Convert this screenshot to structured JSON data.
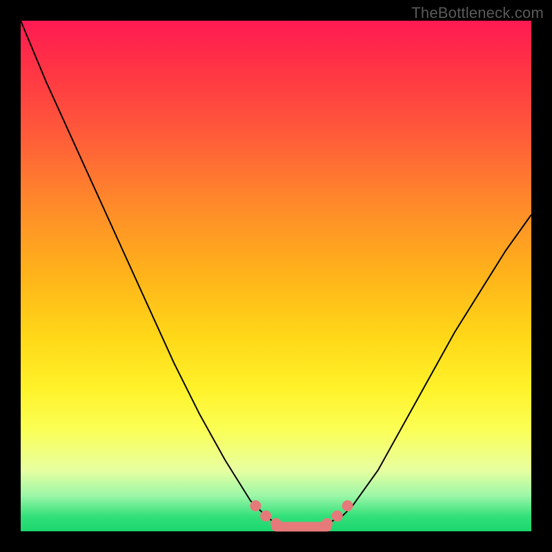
{
  "watermark": "TheBottleneck.com",
  "colors": {
    "frame": "#000000",
    "curve": "#000000",
    "markers": "#e67a7a",
    "gradient_top": "#ff1a53",
    "gradient_bottom": "#1bd66e"
  },
  "chart_data": {
    "type": "line",
    "title": "",
    "xlabel": "",
    "ylabel": "",
    "xlim": [
      0,
      100
    ],
    "ylim": [
      0,
      100
    ],
    "x": [
      0,
      5,
      10,
      15,
      20,
      25,
      30,
      35,
      40,
      45,
      48,
      50,
      53,
      56,
      60,
      63,
      65,
      70,
      75,
      80,
      85,
      90,
      95,
      100
    ],
    "y": [
      100,
      88,
      77,
      66,
      55,
      44,
      33,
      23,
      14,
      6,
      3,
      1.5,
      0.8,
      0.8,
      1.5,
      3,
      5,
      12,
      21,
      30,
      39,
      47,
      55,
      62
    ],
    "marker_points": [
      {
        "x": 46,
        "y": 5
      },
      {
        "x": 48,
        "y": 3
      },
      {
        "x": 50,
        "y": 1.5
      },
      {
        "x": 60,
        "y": 1.5
      },
      {
        "x": 62,
        "y": 3
      },
      {
        "x": 64,
        "y": 5
      }
    ],
    "marker_segment": {
      "x0": 50,
      "x1": 60,
      "y": 0.9
    }
  }
}
